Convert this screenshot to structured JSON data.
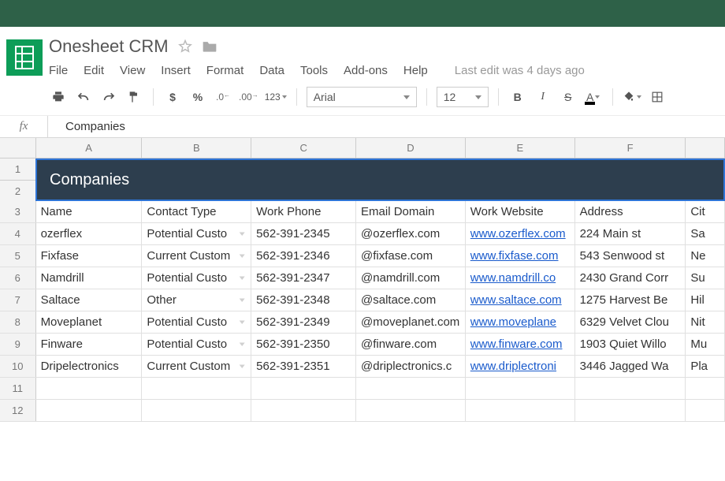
{
  "doc": {
    "title": "Onesheet CRM",
    "last_edit": "Last edit was 4 days ago"
  },
  "menu": {
    "file": "File",
    "edit": "Edit",
    "view": "View",
    "insert": "Insert",
    "format": "Format",
    "data": "Data",
    "tools": "Tools",
    "addons": "Add-ons",
    "help": "Help"
  },
  "toolbar": {
    "dollar": "$",
    "percent": "%",
    "dec_dec": ".0̷",
    "dec_inc": ".00̷",
    "num123": "123",
    "font_name": "Arial",
    "font_size": "12",
    "bold": "B",
    "italic": "I",
    "strike": "S",
    "textcolor": "A"
  },
  "formula": {
    "fx": "fx",
    "value": "Companies"
  },
  "columns": [
    "A",
    "B",
    "C",
    "D",
    "E",
    "F"
  ],
  "banner": "Companies",
  "headers": {
    "name": "Name",
    "contact_type": "Contact Type",
    "work_phone": "Work Phone",
    "email_domain": "Email Domain",
    "work_website": "Work Website",
    "address": "Address",
    "city": "Cit"
  },
  "rows": [
    {
      "n": "4",
      "name": "ozerflex",
      "type": "Potential Custo",
      "phone": "562-391-2345",
      "email": "@ozerflex.com",
      "web": "www.ozerflex.com",
      "addr": "224 Main st",
      "city": "Sa"
    },
    {
      "n": "5",
      "name": "Fixfase",
      "type": "Current Custom",
      "phone": "562-391-2346",
      "email": "@fixfase.com",
      "web": "www.fixfase.com",
      "addr": "543 Senwood st",
      "city": "Ne"
    },
    {
      "n": "6",
      "name": "Namdrill",
      "type": "Potential Custo",
      "phone": "562-391-2347",
      "email": "@namdrill.com",
      "web": "www.namdrill.co",
      "addr": "2430 Grand Corr",
      "city": "Su"
    },
    {
      "n": "7",
      "name": "Saltace",
      "type": "Other",
      "phone": "562-391-2348",
      "email": "@saltace.com",
      "web": "www.saltace.com",
      "addr": "1275 Harvest Be",
      "city": "Hil"
    },
    {
      "n": "8",
      "name": "Moveplanet",
      "type": "Potential Custo",
      "phone": "562-391-2349",
      "email": "@moveplanet.com",
      "web": "www.moveplane",
      "addr": "6329 Velvet Clou",
      "city": "Nit"
    },
    {
      "n": "9",
      "name": "Finware",
      "type": "Potential Custo",
      "phone": "562-391-2350",
      "email": "@finware.com",
      "web": "www.finware.com",
      "addr": "1903 Quiet Willo",
      "city": "Mu"
    },
    {
      "n": "10",
      "name": "Dripelectronics",
      "type": "Current Custom",
      "phone": "562-391-2351",
      "email": "@driplectronics.c",
      "web": "www.driplectroni",
      "addr": "3446 Jagged Wa",
      "city": "Pla"
    }
  ],
  "empty_rows": [
    "11",
    "12"
  ]
}
